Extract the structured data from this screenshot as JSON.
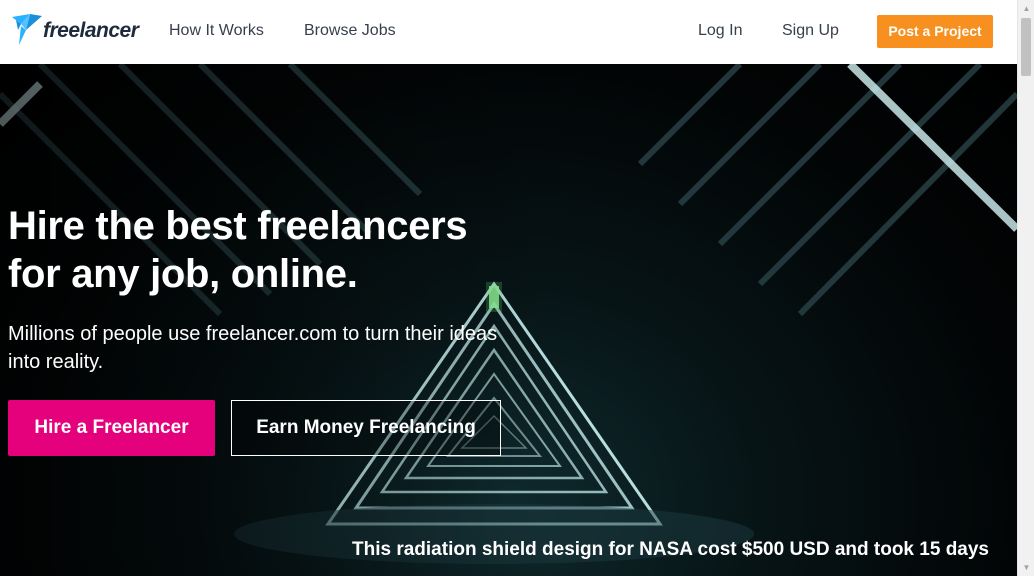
{
  "brand": {
    "logo_text": "freelancer",
    "logo_color": "#29b2fe"
  },
  "nav": {
    "how_it_works": "How It Works",
    "browse_jobs": "Browse Jobs",
    "log_in": "Log In",
    "sign_up": "Sign Up",
    "post_project": "Post a Project"
  },
  "hero": {
    "headline_line1": "Hire the best freelancers",
    "headline_line2": "for any job, online.",
    "subtext": "Millions of people use freelancer.com to turn their ideas into reality.",
    "hire_button": "Hire a Freelancer",
    "earn_button": "Earn Money Freelancing",
    "caption": "This radiation shield design for NASA cost $500 USD and took 15 days"
  },
  "colors": {
    "accent_orange": "#f7901e",
    "accent_pink": "#e5007c",
    "nav_text": "#363f4d"
  },
  "scrollbar": {
    "up_icon": "scroll-up-arrow",
    "down_icon": "scroll-down-arrow"
  }
}
